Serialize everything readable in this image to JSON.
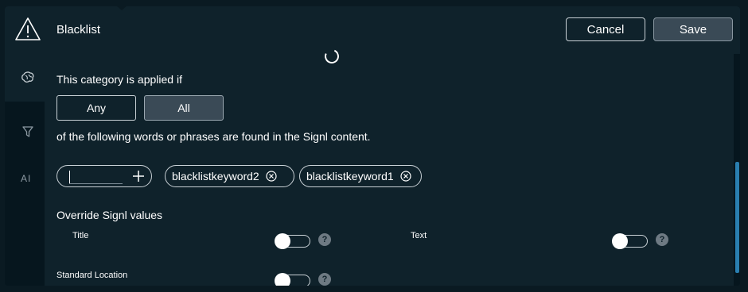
{
  "header": {
    "title": "Blacklist",
    "cancel_label": "Cancel",
    "save_label": "Save",
    "icon": "warning-triangle-icon"
  },
  "sidebar": {
    "items": [
      {
        "icon": "brain-icon",
        "active": true
      },
      {
        "icon": "filter-icon",
        "active": false
      },
      {
        "icon": "ai-text-icon",
        "label": "AI"
      }
    ]
  },
  "category": {
    "intro": "This category is applied if",
    "options": [
      "Any",
      "All"
    ],
    "selected": "All",
    "suffix": "of the following words or phrases are found in the Signl content."
  },
  "keywords": {
    "input_value": "",
    "tags": [
      "blacklistkeyword2",
      "blacklistkeyword1"
    ]
  },
  "override": {
    "heading": "Override Signl values",
    "fields": [
      {
        "label": "Title",
        "on": false
      },
      {
        "label": "Text",
        "on": false
      },
      {
        "label": "Standard Location",
        "on": false
      }
    ],
    "help_glyph": "?"
  },
  "colors": {
    "background": "#0f222b",
    "selected_button": "#3a4a56",
    "scrollbar": "#2a7fb0"
  }
}
